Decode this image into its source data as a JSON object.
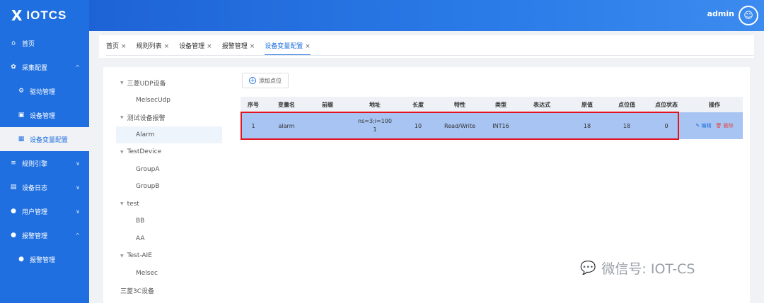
{
  "app": {
    "logo_mark": "X",
    "logo_text": "IOTCS"
  },
  "header": {
    "admin": "admin"
  },
  "sidebar": {
    "items": [
      {
        "label": "首页",
        "icon": "home-icon",
        "glyph": "⌂"
      },
      {
        "label": "采集配置",
        "icon": "gear-icon",
        "glyph": "✿",
        "chev": "^"
      },
      {
        "label": "驱动管理",
        "icon": "plugin-icon",
        "glyph": "⚙"
      },
      {
        "label": "设备管理",
        "icon": "device-icon",
        "glyph": "▣"
      },
      {
        "label": "设备变量配置",
        "icon": "grid-icon",
        "glyph": "▦"
      },
      {
        "label": "规则引擎",
        "icon": "sliders-icon",
        "glyph": "≡",
        "chev": "∨"
      },
      {
        "label": "设备日志",
        "icon": "log-icon",
        "glyph": "▤",
        "chev": "∨"
      },
      {
        "label": "用户管理",
        "icon": "user-icon",
        "glyph": "●",
        "chev": "∨"
      },
      {
        "label": "报警管理",
        "icon": "user-icon",
        "glyph": "●",
        "chev": "^"
      },
      {
        "label": "报警管理",
        "icon": "user-icon",
        "glyph": "●"
      }
    ]
  },
  "tabs": [
    {
      "label": "首页",
      "close": "×"
    },
    {
      "label": "规则列表",
      "close": "×"
    },
    {
      "label": "设备管理",
      "close": "×"
    },
    {
      "label": "报警管理",
      "close": "×"
    },
    {
      "label": "设备变量配置",
      "close": "×"
    }
  ],
  "tree": [
    {
      "label": "三菱UDP设备",
      "arrow": "▼"
    },
    {
      "label": "MelsecUdp"
    },
    {
      "label": "测试设备报警",
      "arrow": "▼"
    },
    {
      "label": "Alarm"
    },
    {
      "label": "TestDevice",
      "arrow": "▼"
    },
    {
      "label": "GroupA"
    },
    {
      "label": "GroupB"
    },
    {
      "label": "test",
      "arrow": "▼"
    },
    {
      "label": "BB"
    },
    {
      "label": "AA"
    },
    {
      "label": "Test-AIE",
      "arrow": "▼"
    },
    {
      "label": "Melsec"
    },
    {
      "label": "三菱3C设备"
    }
  ],
  "toolbar": {
    "add_label": "添加点位",
    "add_icon": "+"
  },
  "table": {
    "headers": [
      "序号",
      "变量名",
      "前缀",
      "地址",
      "长度",
      "特性",
      "类型",
      "表达式",
      "原值",
      "点位值",
      "点位状态",
      "操作"
    ],
    "row": {
      "index": "1",
      "name": "alarm",
      "prefix": "",
      "address_line1": "ns=3;i=100",
      "address_line2": "1",
      "length": "10",
      "access": "Read/Write",
      "type": "INT16",
      "expression": "",
      "raw": "18",
      "value": "18",
      "status": "0",
      "edit_icon": "✎",
      "edit": "编辑",
      "delete_icon": "🗑",
      "delete": "删除"
    }
  },
  "watermark": {
    "icon": "wechat-icon",
    "glyph": "💬",
    "text": "微信号: IOT-CS"
  }
}
